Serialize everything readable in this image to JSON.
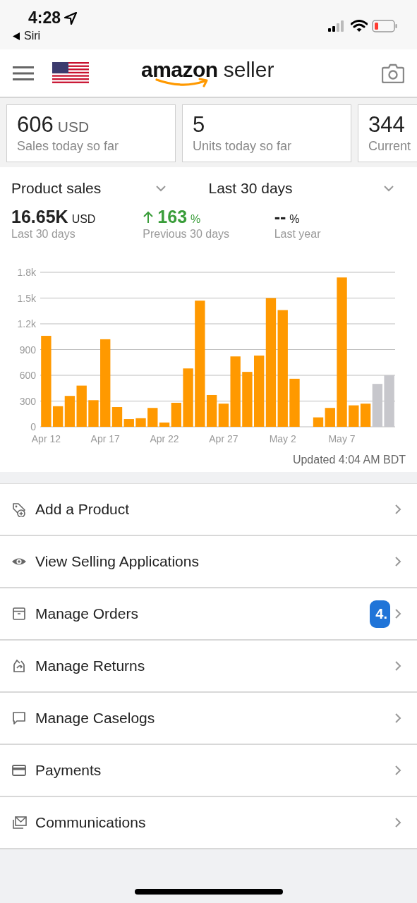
{
  "status_bar": {
    "time": "4:28",
    "back_label": "Siri"
  },
  "header": {
    "logo": {
      "brand": "amazon",
      "product": "seller"
    }
  },
  "kpi_cards": [
    {
      "value": "606",
      "unit": "USD",
      "label": "Sales today so far"
    },
    {
      "value": "5",
      "label": "Units today so far"
    },
    {
      "value": "344",
      "label": "Current"
    }
  ],
  "filters": [
    {
      "label": "Product sales"
    },
    {
      "label": "Last 30 days"
    }
  ],
  "metrics": [
    {
      "kind": "total",
      "value": "16.65K",
      "unit": "USD",
      "label": "Last 30 days"
    },
    {
      "kind": "up",
      "value": "163",
      "unit": "%",
      "label": "Previous 30 days"
    },
    {
      "kind": "plain",
      "value": "--",
      "unit": "%",
      "label": "Last year"
    }
  ],
  "chart_data": {
    "type": "bar",
    "grid": true,
    "stacked": true,
    "categories": [
      "Apr 12",
      null,
      null,
      null,
      null,
      "Apr 17",
      null,
      null,
      null,
      null,
      "Apr 22",
      null,
      null,
      null,
      null,
      "Apr 27",
      null,
      null,
      null,
      null,
      "May 2",
      null,
      null,
      null,
      null,
      "May 7",
      null,
      null,
      null,
      null
    ],
    "series": [
      {
        "color": "#ff9900",
        "values": [
          1060,
          240,
          360,
          480,
          310,
          1020,
          230,
          90,
          100,
          220,
          50,
          280,
          680,
          1470,
          370,
          270,
          820,
          640,
          830,
          1500,
          1360,
          560,
          0,
          110,
          220,
          1740,
          250,
          270,
          null,
          null
        ]
      },
      {
        "color": "#c7c7cc",
        "values": [
          null,
          null,
          null,
          null,
          null,
          null,
          null,
          null,
          null,
          null,
          null,
          null,
          null,
          null,
          null,
          null,
          null,
          null,
          null,
          null,
          null,
          null,
          null,
          null,
          null,
          null,
          null,
          null,
          500,
          600
        ]
      }
    ],
    "ylim": [
      0,
      1800
    ],
    "yticks": [
      0,
      300,
      600,
      900,
      {
        "value": 1200,
        "label": "1.2k"
      },
      {
        "value": 1500,
        "label": "1.5k"
      },
      {
        "value": 1800,
        "label": "1.8k"
      }
    ]
  },
  "updated": "Updated 4:04 AM BDT",
  "menu": [
    {
      "kind": "tag",
      "label": "Add a Product"
    },
    {
      "kind": "eye",
      "label": "View Selling Applications"
    },
    {
      "kind": "box",
      "label": "Manage Orders",
      "badge": "4."
    },
    {
      "kind": "return",
      "label": "Manage Returns"
    },
    {
      "kind": "chat",
      "label": "Manage Caselogs"
    },
    {
      "kind": "card",
      "label": "Payments"
    },
    {
      "kind": "mail",
      "label": "Communications"
    }
  ]
}
